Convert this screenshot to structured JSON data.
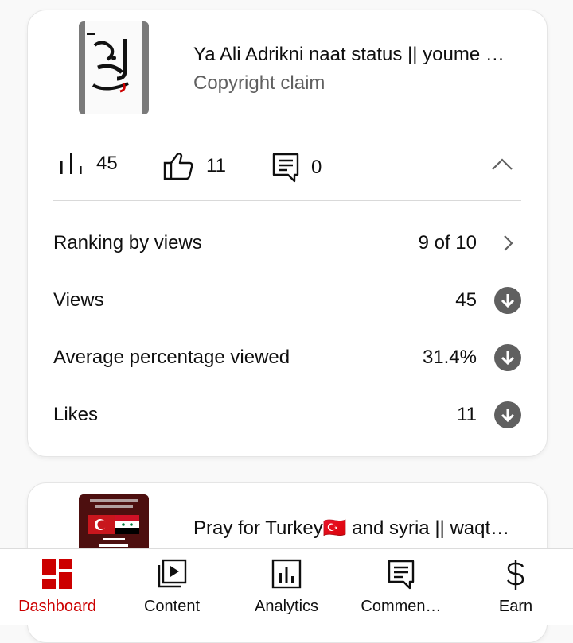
{
  "video1": {
    "title": "Ya Ali Adrikni naat status || youme …",
    "subtitle": "Copyright claim",
    "thumbnail_text": "يا علي مدد",
    "views_count": "45",
    "likes_count": "11",
    "comments_count": "0",
    "details": [
      {
        "label": "Ranking by views",
        "value": "9 of 10",
        "icon": "chevron-right-icon"
      },
      {
        "label": "Views",
        "value": "45",
        "icon": "arrow-down-circle-icon"
      },
      {
        "label": "Average percentage viewed",
        "value": "31.4%",
        "icon": "arrow-down-circle-icon"
      },
      {
        "label": "Likes",
        "value": "11",
        "icon": "arrow-down-circle-icon"
      }
    ]
  },
  "video2": {
    "title": "Pray for Turkey🇹🇷 and syria || waqt…",
    "thumbnail_text": "PRAY FOR TURKEY"
  },
  "nav": {
    "items": [
      {
        "label": "Dashboard",
        "icon": "dashboard-icon",
        "active": true
      },
      {
        "label": "Content",
        "icon": "content-icon",
        "active": false
      },
      {
        "label": "Analytics",
        "icon": "analytics-icon",
        "active": false
      },
      {
        "label": "Commen…",
        "icon": "comments-icon",
        "active": false
      },
      {
        "label": "Earn",
        "icon": "dollar-icon",
        "active": false
      }
    ]
  },
  "colors": {
    "accent": "#cc0000",
    "text": "#0f0f0f",
    "secondary_text": "#606060",
    "icon_gray": "#606060"
  }
}
